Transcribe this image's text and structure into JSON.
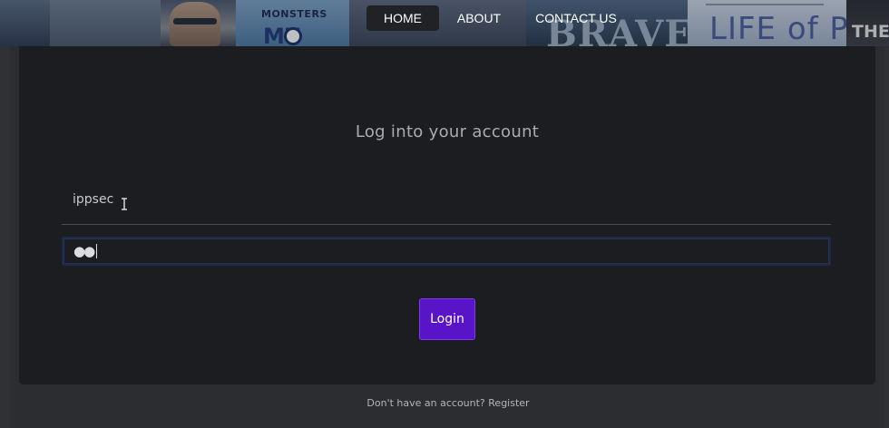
{
  "banner": {
    "posters": {
      "monsters": "MONSTERS",
      "monsters_sub": "MU",
      "brave": "BRAVE",
      "life_of_pi": "LIFE of PI",
      "they": "THEY"
    }
  },
  "nav": {
    "items": [
      {
        "label": "HOME",
        "active": true
      },
      {
        "label": "ABOUT",
        "active": false
      },
      {
        "label": "CONTACT US",
        "active": false
      }
    ]
  },
  "login": {
    "title": "Log into your account",
    "username_value": "ippsec",
    "password_masked": "●●",
    "button_label": "Login"
  },
  "footer": {
    "prompt": "Don't have an account?",
    "register_label": "Register"
  },
  "colors": {
    "accent": "#5a14c8",
    "card": "#1b1d20",
    "page": "#2b2d30"
  },
  "icons": {
    "text_cursor": "text-cursor-icon"
  }
}
